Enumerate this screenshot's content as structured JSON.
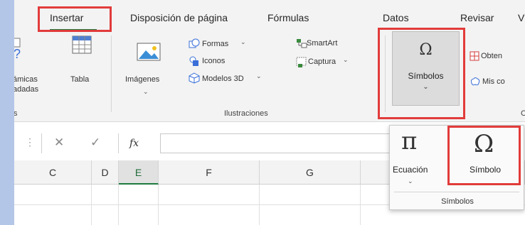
{
  "tabs": [
    {
      "label": "Insertar"
    },
    {
      "label": "Disposición de página"
    },
    {
      "label": "Fórmulas"
    },
    {
      "label": "Datos"
    },
    {
      "label": "Revisar"
    },
    {
      "label": "V"
    }
  ],
  "ribbon": {
    "tablas": {
      "partial_line1": "ámicas",
      "partial_line2": "adadas",
      "tabla_label": "Tabla",
      "group_partial": "s"
    },
    "ilustraciones": {
      "imagenes_label": "Imágenes",
      "formas_label": "Formas",
      "iconos_label": "Iconos",
      "modelos_label": "Modelos 3D",
      "group_label": "Ilustraciones"
    },
    "smartart_label": "SmartArt",
    "captura_label": "Captura",
    "simbolos_label": "Símbolos",
    "obten_label": "Obten",
    "miscomp_label": "Mis co",
    "group_partial_right": "C"
  },
  "formula_bar": {
    "fx": "fx"
  },
  "columns": [
    {
      "label": "C"
    },
    {
      "label": "D"
    },
    {
      "label": "E"
    },
    {
      "label": "F"
    },
    {
      "label": "G"
    },
    {
      "label": ""
    },
    {
      "label": ""
    }
  ],
  "dropdown": {
    "ecuacion_symbol": "π",
    "ecuacion_label": "Ecuación",
    "simbolo_symbol": "Ω",
    "simbolo_label": "Símbolo",
    "group_label": "Símbolos"
  },
  "colors": {
    "accent_green": "#1f7a3e",
    "highlight_red": "#e23b3b"
  }
}
